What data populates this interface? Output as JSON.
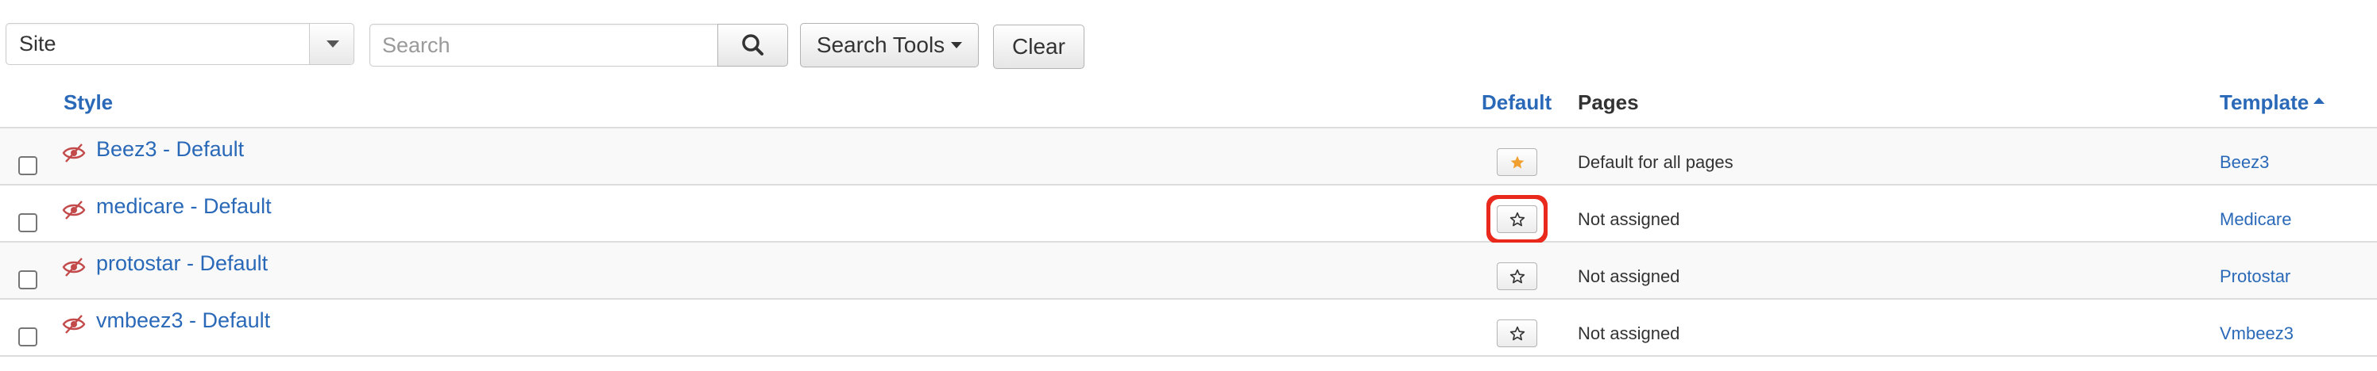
{
  "filters": {
    "client_value": "Site",
    "search_placeholder": "Search",
    "search_tools_label": "Search Tools",
    "clear_label": "Clear"
  },
  "table": {
    "headers": {
      "style": "Style",
      "default": "Default",
      "pages": "Pages",
      "template": "Template"
    },
    "sort_column": "template",
    "sort_direction": "ascending",
    "rows": [
      {
        "style": "Beez3 - Default",
        "is_default": true,
        "pages": "Default for all pages",
        "template": "Beez3"
      },
      {
        "style": "medicare - Default",
        "is_default": false,
        "pages": "Not assigned",
        "template": "Medicare"
      },
      {
        "style": "protostar - Default",
        "is_default": false,
        "pages": "Not assigned",
        "template": "Protostar"
      },
      {
        "style": "vmbeez3 - Default",
        "is_default": false,
        "pages": "Not assigned",
        "template": "Vmbeez3"
      }
    ]
  },
  "icons": {
    "search": "magnifier-icon",
    "status": "eye-slash-icon",
    "default_on": "star-filled-icon",
    "default_off": "star-outline-icon"
  },
  "colors": {
    "link": "#2a69b8",
    "default_star": "#f0a030",
    "status_icon": "#c24a4a",
    "highlight": "#e8291c"
  }
}
